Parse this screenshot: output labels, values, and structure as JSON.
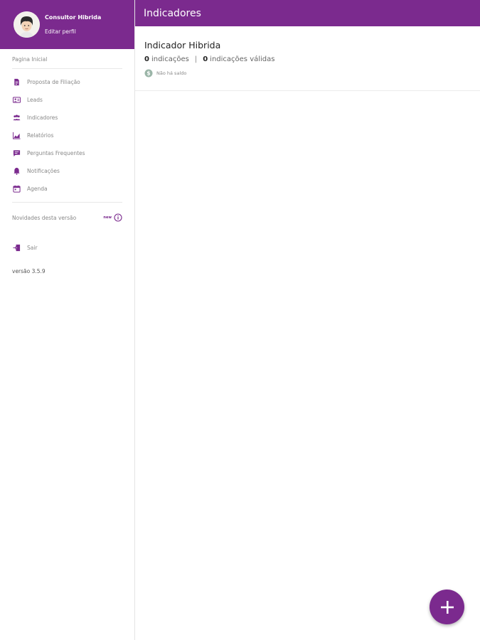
{
  "profile": {
    "name": "Consultor Hibrida",
    "edit_label": "Editar perfil"
  },
  "sidebar": {
    "home_label": "Pagina Inicial",
    "items": [
      {
        "label": "Proposta de Filiação",
        "icon": "document-icon"
      },
      {
        "label": "Leads",
        "icon": "leads-icon"
      },
      {
        "label": "Indicadores",
        "icon": "people-icon"
      },
      {
        "label": "Relatórios",
        "icon": "chart-icon"
      },
      {
        "label": "Perguntas Frequentes",
        "icon": "chat-icon"
      },
      {
        "label": "Notificações",
        "icon": "bell-icon"
      },
      {
        "label": "Agenda",
        "icon": "calendar-icon"
      }
    ],
    "news_label": "Novidades desta versão",
    "news_badge": "new",
    "logout_label": "Sair",
    "version": "versão 3.5.9"
  },
  "header": {
    "title": "Indicadores"
  },
  "card": {
    "title": "Indicador Hibrida",
    "indications_count": "0",
    "indications_label": "indicações",
    "separator": "|",
    "valid_count": "0",
    "valid_label": "indicações válidas",
    "balance_label": "Não há saldo"
  },
  "colors": {
    "primary": "#7b2a8e",
    "balance_icon": "#9bb5a8"
  }
}
